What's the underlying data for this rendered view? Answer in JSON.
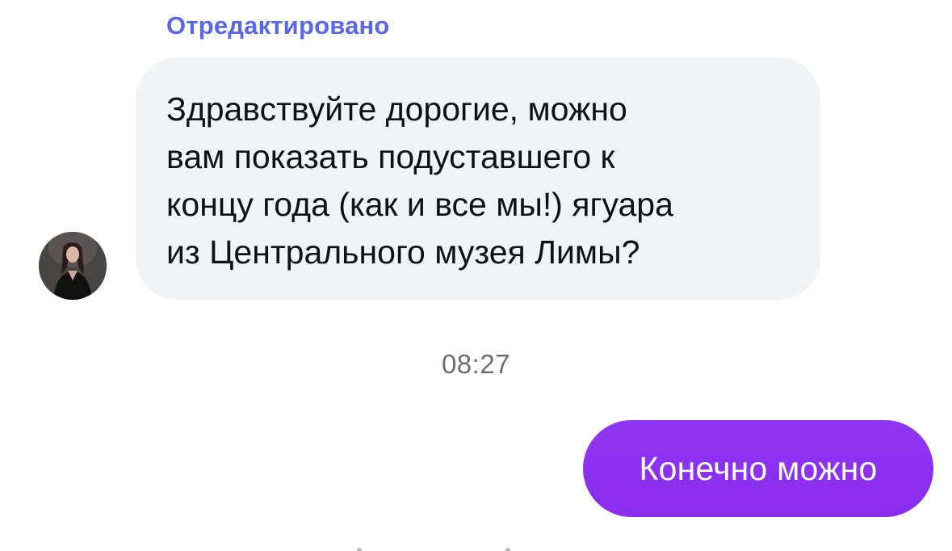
{
  "messages": {
    "incoming": {
      "edited_label": "Отредактировано",
      "text": "Здравствуйте дорогие, можно\nвам показать подуставшего к\nконцу года (как и все мы!) ягуара\nиз Центрального музея Лимы?",
      "avatar_icon": "user-avatar-photo"
    },
    "timestamp": "08:27",
    "outgoing": {
      "text": "Конечно можно"
    }
  },
  "colors": {
    "edited_label": "#5a68e8",
    "incoming_bubble": "#f2f3f5",
    "outgoing_bubble": "#8d2ff0",
    "timestamp": "#6e6e73"
  }
}
